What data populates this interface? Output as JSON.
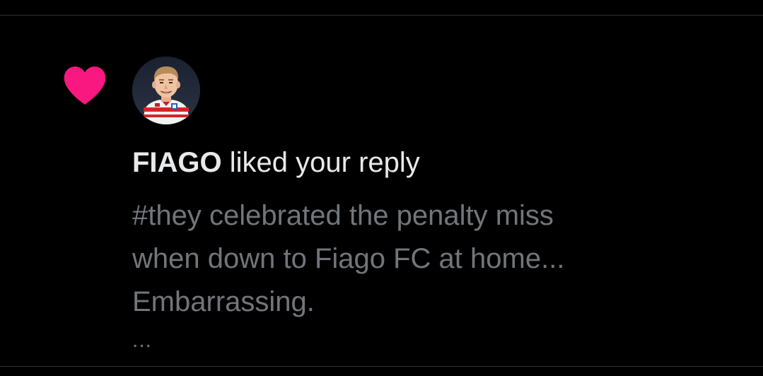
{
  "colors": {
    "background": "#000000",
    "like_heart": "#f91880",
    "primary_text": "#e7e9ea",
    "secondary_text": "#71767b",
    "divider": "#2f3336"
  },
  "notification": {
    "icon": "heart-icon",
    "avatar": "avatar-illustration",
    "user_name": "FIAGO",
    "action_text": " liked your reply",
    "reply_lines": [
      "#they celebrated the penalty miss",
      "when down to Fiago FC at home...",
      "Embarrassing."
    ],
    "more_indicator": "..."
  }
}
